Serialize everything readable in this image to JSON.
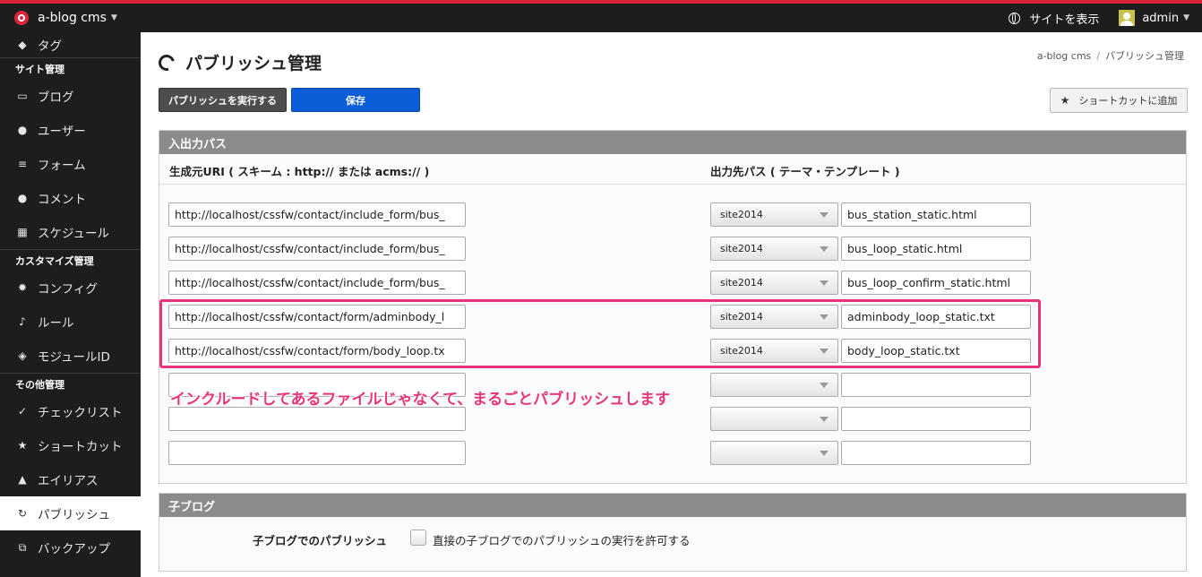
{
  "topbar": {
    "brand": "a-blog cms",
    "view_site": "サイトを表示",
    "user": "admin"
  },
  "sidebar": {
    "items": [
      {
        "label": "タグ",
        "icon": "tag-icon"
      },
      {
        "section": "サイト管理"
      },
      {
        "label": "ブログ",
        "icon": "blog-icon"
      },
      {
        "label": "ユーザー",
        "icon": "user-icon"
      },
      {
        "label": "フォーム",
        "icon": "form-icon"
      },
      {
        "label": "コメント",
        "icon": "comment-icon"
      },
      {
        "label": "スケジュール",
        "icon": "calendar-icon"
      },
      {
        "section": "カスタマイズ管理"
      },
      {
        "label": "コンフィグ",
        "icon": "gear-icon"
      },
      {
        "label": "ルール",
        "icon": "rule-icon"
      },
      {
        "label": "モジュールID",
        "icon": "module-icon"
      },
      {
        "section": "その他管理"
      },
      {
        "label": "チェックリスト",
        "icon": "check-icon"
      },
      {
        "label": "ショートカット",
        "icon": "star-icon"
      },
      {
        "label": "エイリアス",
        "icon": "alias-icon"
      },
      {
        "label": "パブリッシュ",
        "icon": "publish-icon",
        "active": true
      },
      {
        "label": "バックアップ",
        "icon": "backup-icon"
      }
    ]
  },
  "page": {
    "title": "パブリッシュ管理",
    "breadcrumb": [
      "a-blog cms",
      "パブリッシュ管理"
    ],
    "publish_button": "パブリッシュを実行する",
    "save_button": "保存",
    "shortcut_button": "ショートカットに追加"
  },
  "io": {
    "header": "入出力パス",
    "col_source": "生成元URI ( スキーム : http:// または acms:// )",
    "col_dest": "出力先パス ( テーマ・テンプレート )",
    "rows": [
      {
        "uri": "http://localhost/cssfw/contact/include_form/bus_",
        "theme": "site2014",
        "file": "bus_station_static.html"
      },
      {
        "uri": "http://localhost/cssfw/contact/include_form/bus_",
        "theme": "site2014",
        "file": "bus_loop_static.html"
      },
      {
        "uri": "http://localhost/cssfw/contact/include_form/bus_",
        "theme": "site2014",
        "file": "bus_loop_confirm_static.html"
      },
      {
        "uri": "http://localhost/cssfw/contact/form/adminbody_l",
        "theme": "site2014",
        "file": "adminbody_loop_static.txt"
      },
      {
        "uri": "http://localhost/cssfw/contact/form/body_loop.tx",
        "theme": "site2014",
        "file": "body_loop_static.txt"
      },
      {
        "uri": "",
        "theme": "",
        "file": ""
      },
      {
        "uri": "",
        "theme": "",
        "file": ""
      },
      {
        "uri": "",
        "theme": "",
        "file": ""
      }
    ],
    "annotation": "インクルードしてあるファイルじゃなくて、まるごとパブリッシュします"
  },
  "child": {
    "header": "子ブログ",
    "label": "子ブログでのパブリッシュ",
    "checkbox_text": "直接の子ブログでのパブリッシュの実行を許可する"
  },
  "colors": {
    "accent_red": "#d9263a",
    "highlight_pink": "#e8347a",
    "save_blue": "#0a5fd8"
  }
}
